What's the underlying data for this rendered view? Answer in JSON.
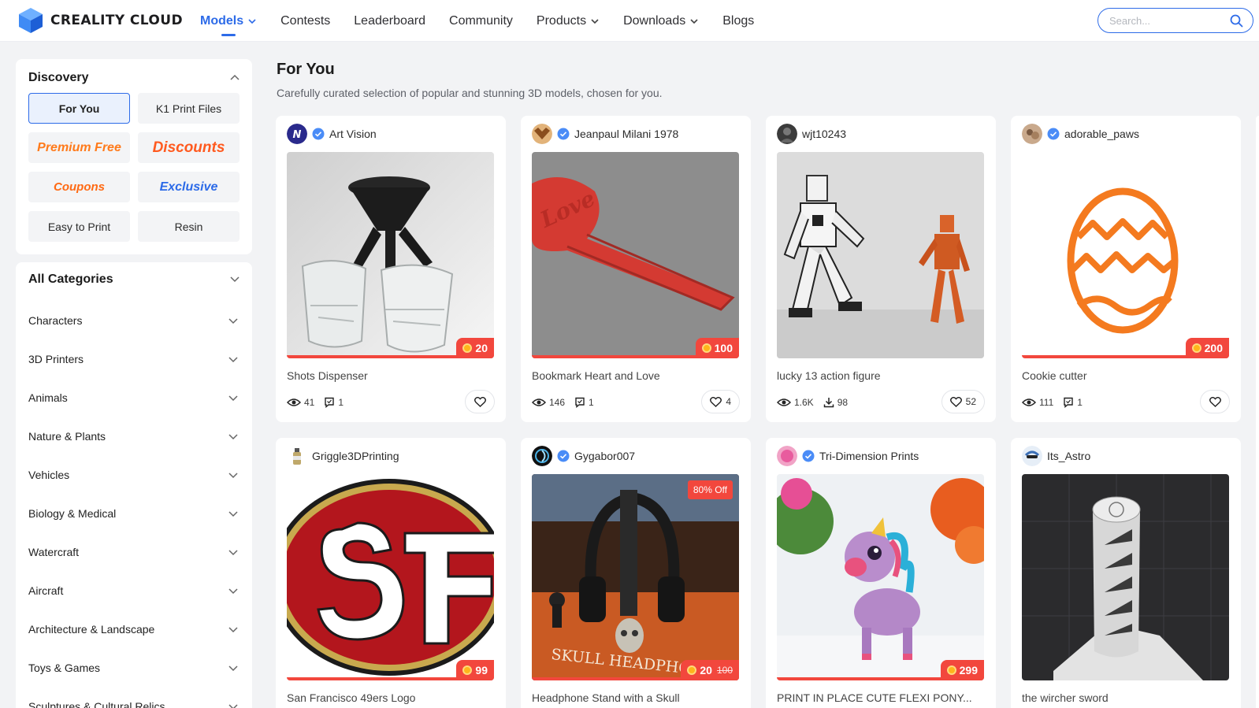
{
  "brand": {
    "name": "CREALITY CLOUD",
    "logo_colors": [
      "#3f8bf5",
      "#1d5fd6",
      "#6fb0ff"
    ]
  },
  "nav": [
    {
      "label": "Models",
      "has_dropdown": true,
      "active": true
    },
    {
      "label": "Contests",
      "has_dropdown": false
    },
    {
      "label": "Leaderboard",
      "has_dropdown": false
    },
    {
      "label": "Community",
      "has_dropdown": false
    },
    {
      "label": "Products",
      "has_dropdown": true
    },
    {
      "label": "Downloads",
      "has_dropdown": true
    },
    {
      "label": "Blogs",
      "has_dropdown": false
    }
  ],
  "search": {
    "placeholder": "Search...",
    "value": ""
  },
  "discovery": {
    "title": "Discovery",
    "chips": [
      {
        "label": "For You",
        "active": true
      },
      {
        "label": "K1 Print Files"
      },
      {
        "label": "Premium Free"
      },
      {
        "label": "Discounts"
      },
      {
        "label": "Coupons"
      },
      {
        "label": "Exclusive"
      },
      {
        "label": "Easy to Print"
      },
      {
        "label": "Resin"
      }
    ]
  },
  "categories": {
    "title": "All Categories",
    "items": [
      "Characters",
      "3D Printers",
      "Animals",
      "Nature & Plants",
      "Vehicles",
      "Biology & Medical",
      "Watercraft",
      "Aircraft",
      "Architecture & Landscape",
      "Toys & Games",
      "Sculptures & Cultural Relics"
    ]
  },
  "main": {
    "title": "For You",
    "subtitle": "Carefully curated selection of popular and stunning 3D models, chosen for you."
  },
  "cards": [
    {
      "author": "Art Vision",
      "verified": true,
      "title": "Shots Dispenser",
      "price": "20",
      "views": "41",
      "stat2": "1",
      "stat2_icon": "comment-icon",
      "likes": ""
    },
    {
      "author": "Jeanpaul Milani 1978",
      "verified": true,
      "title": "Bookmark Heart and Love",
      "price": "100",
      "views": "146",
      "stat2": "1",
      "stat2_icon": "comment-icon",
      "likes": "4"
    },
    {
      "author": "wjt10243",
      "verified": false,
      "title": "lucky 13 action figure",
      "price": "",
      "views": "1.6K",
      "stat2": "98",
      "stat2_icon": "download-icon",
      "likes": "52"
    },
    {
      "author": "adorable_paws",
      "verified": true,
      "title": "Cookie cutter",
      "price": "200",
      "views": "111",
      "stat2": "1",
      "stat2_icon": "comment-icon",
      "likes": ""
    },
    {
      "author": "Griggle3DPrinting",
      "verified": false,
      "title": "San Francisco 49ers Logo",
      "price": "99"
    },
    {
      "author": "Gygabor007",
      "verified": true,
      "title": "Headphone Stand with a Skull",
      "price": "20",
      "old_price": "100",
      "discount": "80% Off",
      "image_caption": "SKULL HEADPHONE"
    },
    {
      "author": "Tri-Dimension Prints",
      "verified": true,
      "title": "PRINT IN PLACE CUTE FLEXI PONY...",
      "price": "299"
    },
    {
      "author": "Its_Astro",
      "verified": false,
      "title": "the wircher sword",
      "price": ""
    }
  ],
  "colors": {
    "accent": "#2d6be8",
    "price": "#f2473d",
    "coin": "#ffb51b"
  }
}
